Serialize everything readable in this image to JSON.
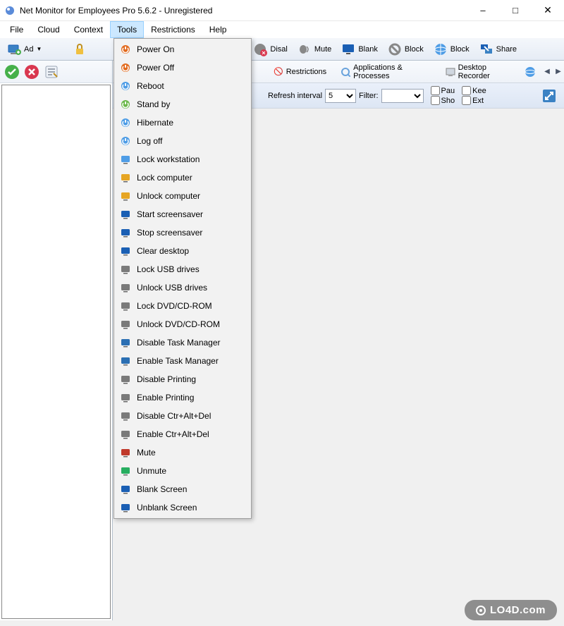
{
  "window": {
    "title": "Net Monitor for Employees Pro 5.6.2 - Unregistered"
  },
  "menubar": {
    "items": [
      "File",
      "Cloud",
      "Context",
      "Tools",
      "Restrictions",
      "Help"
    ],
    "active_index": 3
  },
  "toolbar": {
    "buttons": [
      {
        "label": "Ad",
        "icon": "add-computer-icon",
        "has_dropdown": true
      },
      {
        "label": "",
        "icon": "lock-icon"
      },
      {
        "label": "Disal",
        "icon": "disable-icon"
      },
      {
        "label": "Mute",
        "icon": "mute-icon"
      },
      {
        "label": "Blank",
        "icon": "blank-screen-icon"
      },
      {
        "label": "Block",
        "icon": "block-icon"
      },
      {
        "label": "Block",
        "icon": "block-web-icon"
      },
      {
        "label": "Share",
        "icon": "share-icon"
      }
    ]
  },
  "tabs": {
    "items": [
      {
        "label": "Restrictions",
        "icon": "restrictions-tab-icon"
      },
      {
        "label": "Applications & Processes",
        "icon": "apps-tab-icon"
      },
      {
        "label": "Desktop Recorder",
        "icon": "recorder-tab-icon"
      }
    ],
    "overflow_icon": "globe-icon"
  },
  "filter": {
    "refresh_label": "Refresh interval",
    "refresh_value": "5",
    "filter_label": "Filter:",
    "filter_value": "",
    "checkboxes": {
      "row1": [
        "Pau",
        "Kee"
      ],
      "row2": [
        "Sho",
        "Ext"
      ]
    }
  },
  "tools_menu": {
    "items": [
      {
        "label": "Power On",
        "icon": "power-on-icon",
        "color": "#e26b1f"
      },
      {
        "label": "Power Off",
        "icon": "power-off-icon",
        "color": "#e26b1f"
      },
      {
        "label": "Reboot",
        "icon": "reboot-icon",
        "color": "#4f9de6"
      },
      {
        "label": "Stand by",
        "icon": "standby-icon",
        "color": "#6bb84a"
      },
      {
        "label": "Hibernate",
        "icon": "hibernate-icon",
        "color": "#4f9de6"
      },
      {
        "label": "Log off",
        "icon": "logoff-icon",
        "color": "#4f9de6"
      },
      {
        "label": "Lock workstation",
        "icon": "lock-workstation-icon",
        "color": "#4f9de6"
      },
      {
        "label": "Lock computer",
        "icon": "lock-computer-icon",
        "color": "#e6a523"
      },
      {
        "label": "Unlock computer",
        "icon": "unlock-computer-icon",
        "color": "#e6a523"
      },
      {
        "label": "Start screensaver",
        "icon": "start-screensaver-icon",
        "color": "#1a5fb4"
      },
      {
        "label": "Stop screensaver",
        "icon": "stop-screensaver-icon",
        "color": "#1a5fb4"
      },
      {
        "label": "Clear desktop",
        "icon": "clear-desktop-icon",
        "color": "#1a5fb4"
      },
      {
        "label": "Lock USB drives",
        "icon": "lock-usb-icon",
        "color": "#7a7a7a"
      },
      {
        "label": "Unlock USB drives",
        "icon": "unlock-usb-icon",
        "color": "#7a7a7a"
      },
      {
        "label": "Lock DVD/CD-ROM",
        "icon": "lock-dvd-icon",
        "color": "#7a7a7a"
      },
      {
        "label": "Unlock DVD/CD-ROM",
        "icon": "unlock-dvd-icon",
        "color": "#7a7a7a"
      },
      {
        "label": "Disable Task Manager",
        "icon": "disable-taskmgr-icon",
        "color": "#2b6fb3"
      },
      {
        "label": "Enable Task Manager",
        "icon": "enable-taskmgr-icon",
        "color": "#2b6fb3"
      },
      {
        "label": "Disable Printing",
        "icon": "disable-printing-icon",
        "color": "#7a7a7a"
      },
      {
        "label": "Enable Printing",
        "icon": "enable-printing-icon",
        "color": "#7a7a7a"
      },
      {
        "label": "Disable Ctr+Alt+Del",
        "icon": "disable-cad-icon",
        "color": "#7a7a7a"
      },
      {
        "label": "Enable Ctr+Alt+Del",
        "icon": "enable-cad-icon",
        "color": "#7a7a7a"
      },
      {
        "label": "Mute",
        "icon": "mute-menu-icon",
        "color": "#c0392b"
      },
      {
        "label": "Unmute",
        "icon": "unmute-menu-icon",
        "color": "#27ae60"
      },
      {
        "label": "Blank Screen",
        "icon": "blank-menu-icon",
        "color": "#1a5fb4"
      },
      {
        "label": "Unblank Screen",
        "icon": "unblank-menu-icon",
        "color": "#1a5fb4"
      }
    ]
  },
  "watermark": {
    "text": "LO4D.com"
  }
}
